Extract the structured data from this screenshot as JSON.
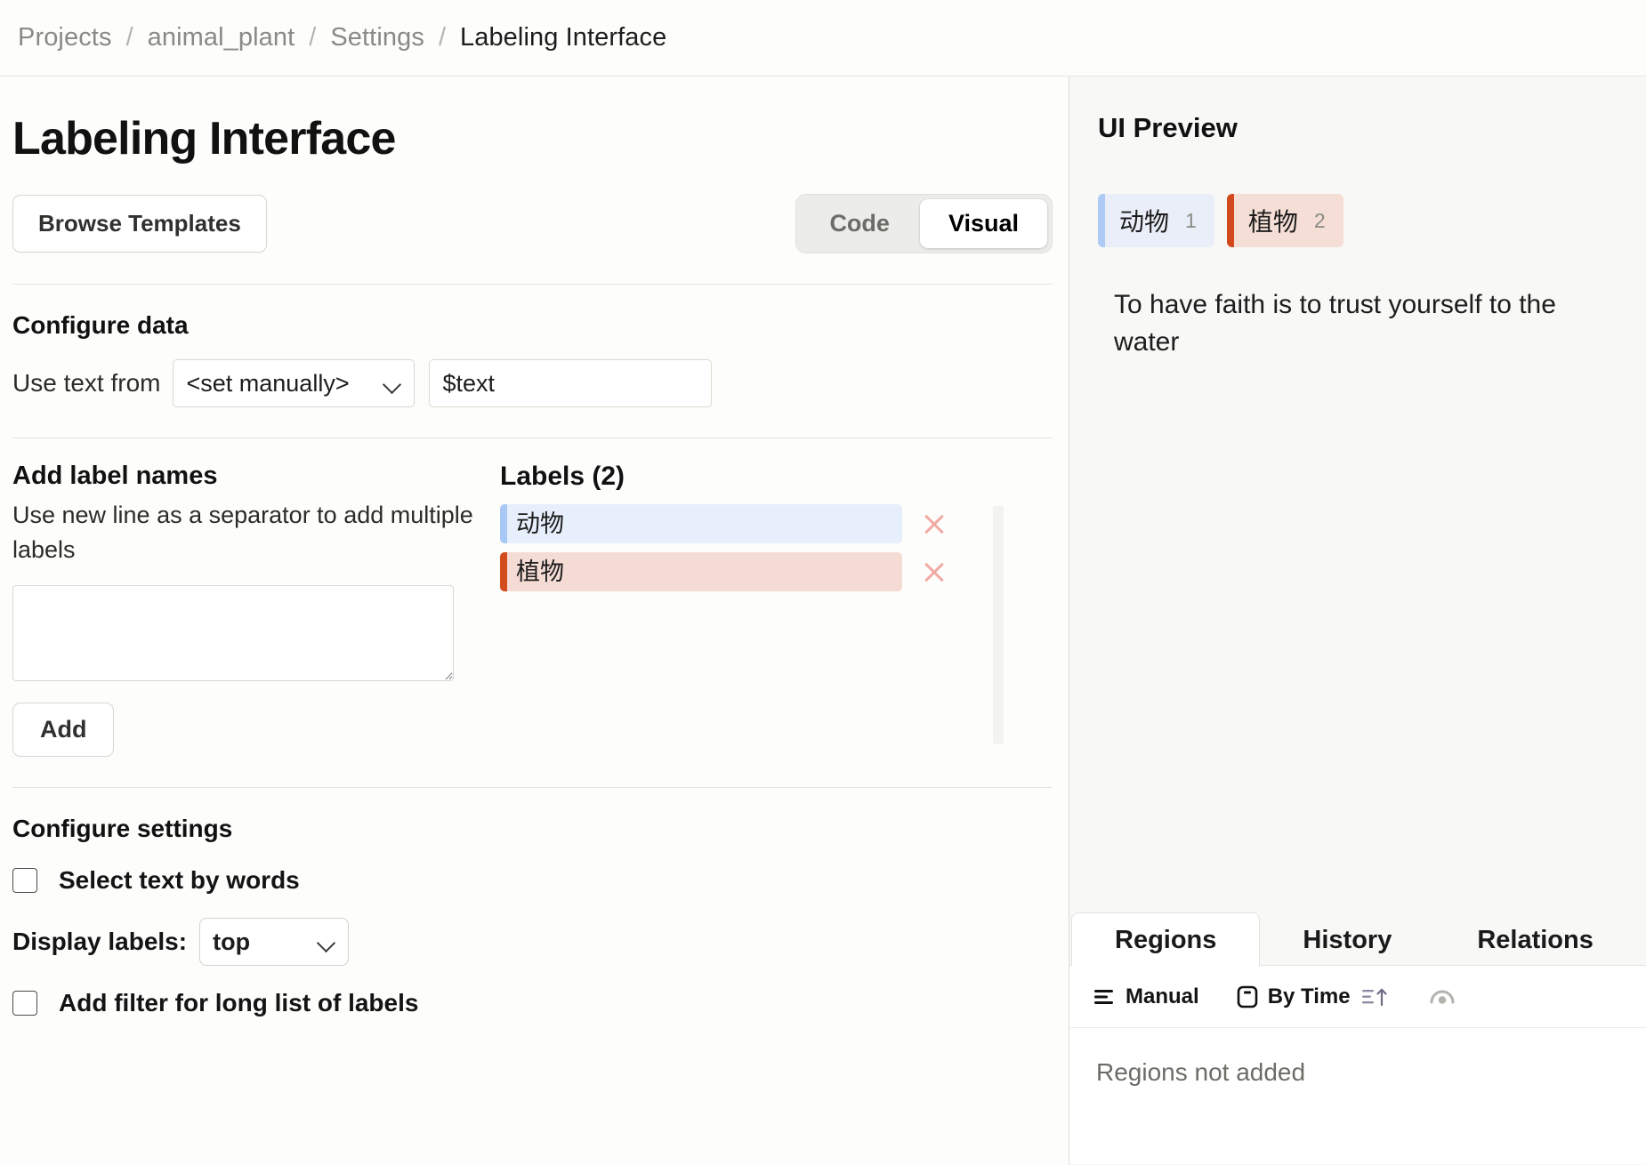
{
  "breadcrumb": {
    "items": [
      {
        "label": "Projects",
        "current": false
      },
      {
        "label": "animal_plant",
        "current": false
      },
      {
        "label": "Settings",
        "current": false
      },
      {
        "label": "Labeling Interface",
        "current": true
      }
    ],
    "separator": "/"
  },
  "page": {
    "title": "Labeling Interface"
  },
  "toolbar": {
    "browse_templates_label": "Browse Templates",
    "mode_code_label": "Code",
    "mode_visual_label": "Visual",
    "active_mode": "Visual"
  },
  "configure_data": {
    "title": "Configure data",
    "use_text_from_label": "Use text from",
    "source_select_value": "<set manually>",
    "value_input_value": "$text",
    "value_input_placeholder": "$text"
  },
  "add_labels": {
    "title": "Add label names",
    "hint": "Use new line as a separator to add multiple labels",
    "textarea_value": "",
    "textarea_placeholder": "",
    "add_button_label": "Add"
  },
  "labels_panel": {
    "heading": "Labels (2)",
    "items": [
      {
        "name": "动物",
        "background": "#e8effc",
        "bar_color": "#a8c8f5",
        "remove_icon": "close-icon"
      },
      {
        "name": "植物",
        "background": "#f4dcd4",
        "bar_color": "#d24c1e",
        "remove_icon": "close-icon"
      }
    ]
  },
  "configure_settings": {
    "title": "Configure settings",
    "select_text_by_words_label": "Select text by words",
    "select_text_by_words_checked": false,
    "display_labels_label": "Display labels:",
    "display_labels_value": "top",
    "add_filter_label": "Add filter for long list of labels",
    "add_filter_checked": false
  },
  "preview": {
    "title": "UI Preview",
    "chips": [
      {
        "name": "动物",
        "hotkey": "1",
        "background": "#e9eef8",
        "bar_color": "#aecbf5"
      },
      {
        "name": "植物",
        "hotkey": "2",
        "background": "#f4ded5",
        "bar_color": "#d2491c"
      }
    ],
    "sample_text": "To have faith is to trust yourself to the water"
  },
  "bottom_panel": {
    "tabs": [
      {
        "label": "Regions",
        "active": true
      },
      {
        "label": "History",
        "active": false
      },
      {
        "label": "Relations",
        "active": false
      }
    ],
    "toolbar": {
      "manual_label": "Manual",
      "manual_icon": "order-lines-icon",
      "by_time_label": "By Time",
      "by_time_icon": "card-icon",
      "sort_icon": "sort-ascending-icon",
      "visibility_icon": "eye-icon"
    },
    "empty_message": "Regions not added"
  },
  "colors": {
    "page_background": "#fdfdfb",
    "panel_background": "#f8f8f6",
    "divider": "#e6e4df",
    "text_primary": "#1d1d1d",
    "text_muted": "#8a8a85",
    "remove_icon": "#f2aaa4"
  }
}
